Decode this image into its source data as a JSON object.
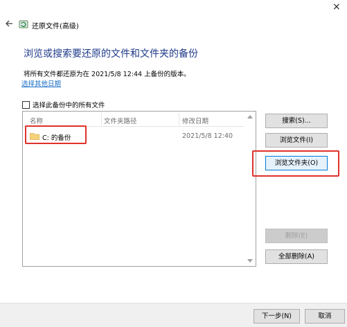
{
  "window": {
    "title": "还原文件(高级)",
    "close_glyph": "×"
  },
  "header": {
    "heading": "浏览或搜索要还原的文件和文件夹的备份",
    "restore_text": "将所有文件都还原为在 2021/5/8 12:44 上备份的版本。",
    "other_date_link": "选择其他日期"
  },
  "select_all_label": "选择此备份中的所有文件",
  "list": {
    "columns": [
      "名称",
      "文件夹路径",
      "修改日期"
    ],
    "rows": [
      {
        "name": "C: 的备份",
        "path": "",
        "modified": "2021/5/8 12:40"
      }
    ]
  },
  "buttons": {
    "search": "搜索(S)...",
    "browse_files": "浏览文件(I)",
    "browse_folders": "浏览文件夹(O)",
    "delete": "删除(E)",
    "delete_all": "全部删除(A)",
    "next": "下一步(N)",
    "cancel": "取消"
  },
  "icons": {
    "back": "back-arrow-icon",
    "title": "backup-restore-icon",
    "folder": "folder-icon"
  },
  "colors": {
    "heading": "#1e3a8a",
    "link": "#1a6fc7",
    "highlight": "#e0302a",
    "focus_border": "#0078d7"
  }
}
